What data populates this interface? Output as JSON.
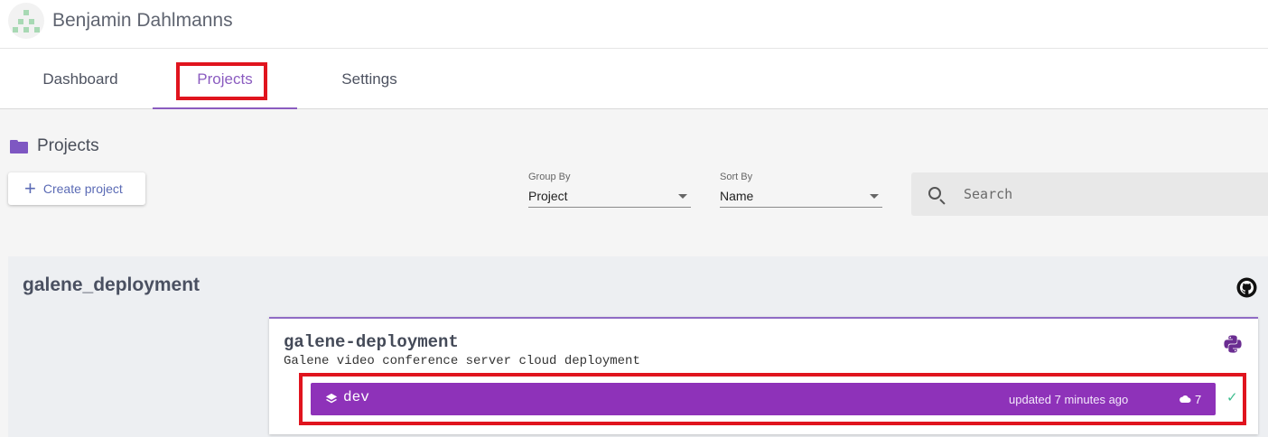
{
  "header": {
    "user_name": "Benjamin Dahlmanns"
  },
  "tabs": [
    {
      "label": "Dashboard"
    },
    {
      "label": "Projects",
      "active": true
    },
    {
      "label": "Settings"
    }
  ],
  "projects": {
    "title": "Projects",
    "create_label": "Create project",
    "group_by": {
      "caption": "Group By",
      "value": "Project"
    },
    "sort_by": {
      "caption": "Sort By",
      "value": "Name"
    },
    "search": {
      "placeholder": "Search"
    }
  },
  "group": {
    "title": "galene_deployment",
    "stack": {
      "name": "galene-deployment",
      "description": "Galene video conference server cloud deployment",
      "env": {
        "name": "dev",
        "updated": "updated 7 minutes ago",
        "resources": "7"
      }
    }
  },
  "colors": {
    "accent": "#8b5cc0",
    "env_bar": "#8e32b9",
    "highlight": "#e0141e",
    "success": "#3dbd8e"
  },
  "icons": [
    "avatar",
    "folder-icon",
    "plus-icon",
    "caret-icon",
    "search-icon",
    "github-icon",
    "python-icon",
    "layers-icon",
    "cloud-icon",
    "check-icon"
  ]
}
